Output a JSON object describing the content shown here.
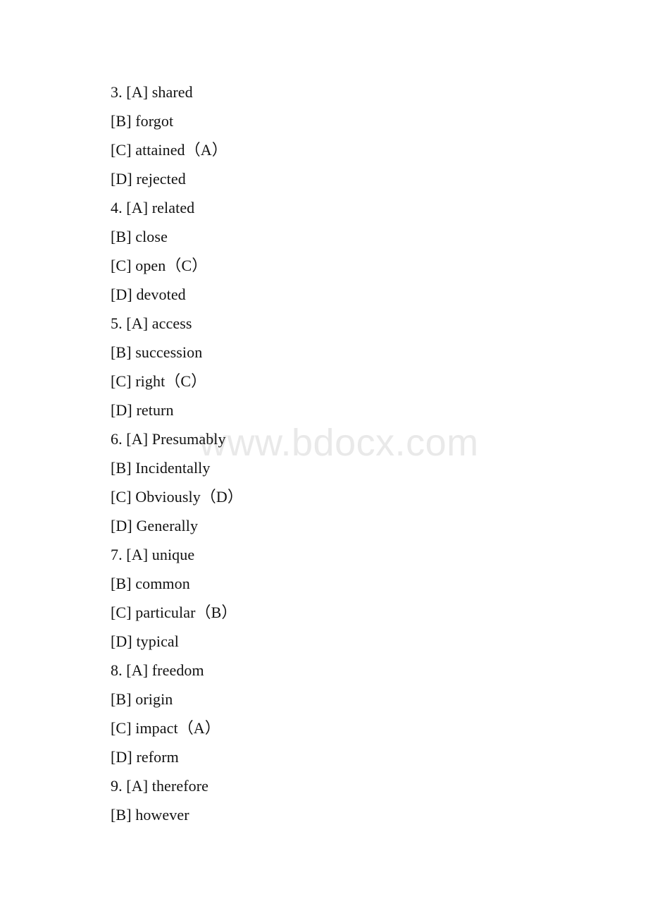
{
  "document": {
    "page_background": "#ffffff",
    "text_color": "#121212",
    "watermark": {
      "text": "www.bdocx.com",
      "color": "#e9e9e9"
    },
    "lines": [
      {
        "id": "q3-a",
        "text": "3. [A] shared",
        "question": "3",
        "choice": "A",
        "word": "shared",
        "answer_marker": ""
      },
      {
        "id": "q3-b",
        "text": "[B] forgot",
        "question": "3",
        "choice": "B",
        "word": "forgot",
        "answer_marker": ""
      },
      {
        "id": "q3-c",
        "text": "[C] attained（A）",
        "question": "3",
        "choice": "C",
        "word": "attained",
        "answer_marker": "A"
      },
      {
        "id": "q3-d",
        "text": "[D] rejected",
        "question": "3",
        "choice": "D",
        "word": "rejected",
        "answer_marker": ""
      },
      {
        "id": "q4-a",
        "text": "4. [A] related",
        "question": "4",
        "choice": "A",
        "word": "related",
        "answer_marker": ""
      },
      {
        "id": "q4-b",
        "text": "[B] close",
        "question": "4",
        "choice": "B",
        "word": "close",
        "answer_marker": ""
      },
      {
        "id": "q4-c",
        "text": "[C] open（C）",
        "question": "4",
        "choice": "C",
        "word": "open",
        "answer_marker": "C"
      },
      {
        "id": "q4-d",
        "text": "[D] devoted",
        "question": "4",
        "choice": "D",
        "word": "devoted",
        "answer_marker": ""
      },
      {
        "id": "q5-a",
        "text": "5. [A] access",
        "question": "5",
        "choice": "A",
        "word": "access",
        "answer_marker": ""
      },
      {
        "id": "q5-b",
        "text": "[B] succession",
        "question": "5",
        "choice": "B",
        "word": "succession",
        "answer_marker": ""
      },
      {
        "id": "q5-c",
        "text": "[C] right（C）",
        "question": "5",
        "choice": "C",
        "word": "right",
        "answer_marker": "C"
      },
      {
        "id": "q5-d",
        "text": "[D] return",
        "question": "5",
        "choice": "D",
        "word": "return",
        "answer_marker": ""
      },
      {
        "id": "q6-a",
        "text": "6. [A] Presumably",
        "question": "6",
        "choice": "A",
        "word": "Presumably",
        "answer_marker": ""
      },
      {
        "id": "q6-b",
        "text": "[B] Incidentally",
        "question": "6",
        "choice": "B",
        "word": "Incidentally",
        "answer_marker": ""
      },
      {
        "id": "q6-c",
        "text": "[C] Obviously（D）",
        "question": "6",
        "choice": "C",
        "word": "Obviously",
        "answer_marker": "D"
      },
      {
        "id": "q6-d",
        "text": "[D] Generally",
        "question": "6",
        "choice": "D",
        "word": "Generally",
        "answer_marker": ""
      },
      {
        "id": "q7-a",
        "text": "7. [A] unique",
        "question": "7",
        "choice": "A",
        "word": "unique",
        "answer_marker": ""
      },
      {
        "id": "q7-b",
        "text": "[B] common",
        "question": "7",
        "choice": "B",
        "word": "common",
        "answer_marker": ""
      },
      {
        "id": "q7-c",
        "text": "[C] particular（B）",
        "question": "7",
        "choice": "C",
        "word": "particular",
        "answer_marker": "B"
      },
      {
        "id": "q7-d",
        "text": "[D] typical",
        "question": "7",
        "choice": "D",
        "word": "typical",
        "answer_marker": ""
      },
      {
        "id": "q8-a",
        "text": "8. [A] freedom",
        "question": "8",
        "choice": "A",
        "word": "freedom",
        "answer_marker": ""
      },
      {
        "id": "q8-b",
        "text": "[B] origin",
        "question": "8",
        "choice": "B",
        "word": "origin",
        "answer_marker": ""
      },
      {
        "id": "q8-c",
        "text": "[C] impact（A）",
        "question": "8",
        "choice": "C",
        "word": "impact",
        "answer_marker": "A"
      },
      {
        "id": "q8-d",
        "text": "[D] reform",
        "question": "8",
        "choice": "D",
        "word": "reform",
        "answer_marker": ""
      },
      {
        "id": "q9-a",
        "text": "9. [A] therefore",
        "question": "9",
        "choice": "A",
        "word": "therefore",
        "answer_marker": ""
      },
      {
        "id": "q9-b",
        "text": "[B] however",
        "question": "9",
        "choice": "B",
        "word": "however",
        "answer_marker": ""
      }
    ]
  }
}
